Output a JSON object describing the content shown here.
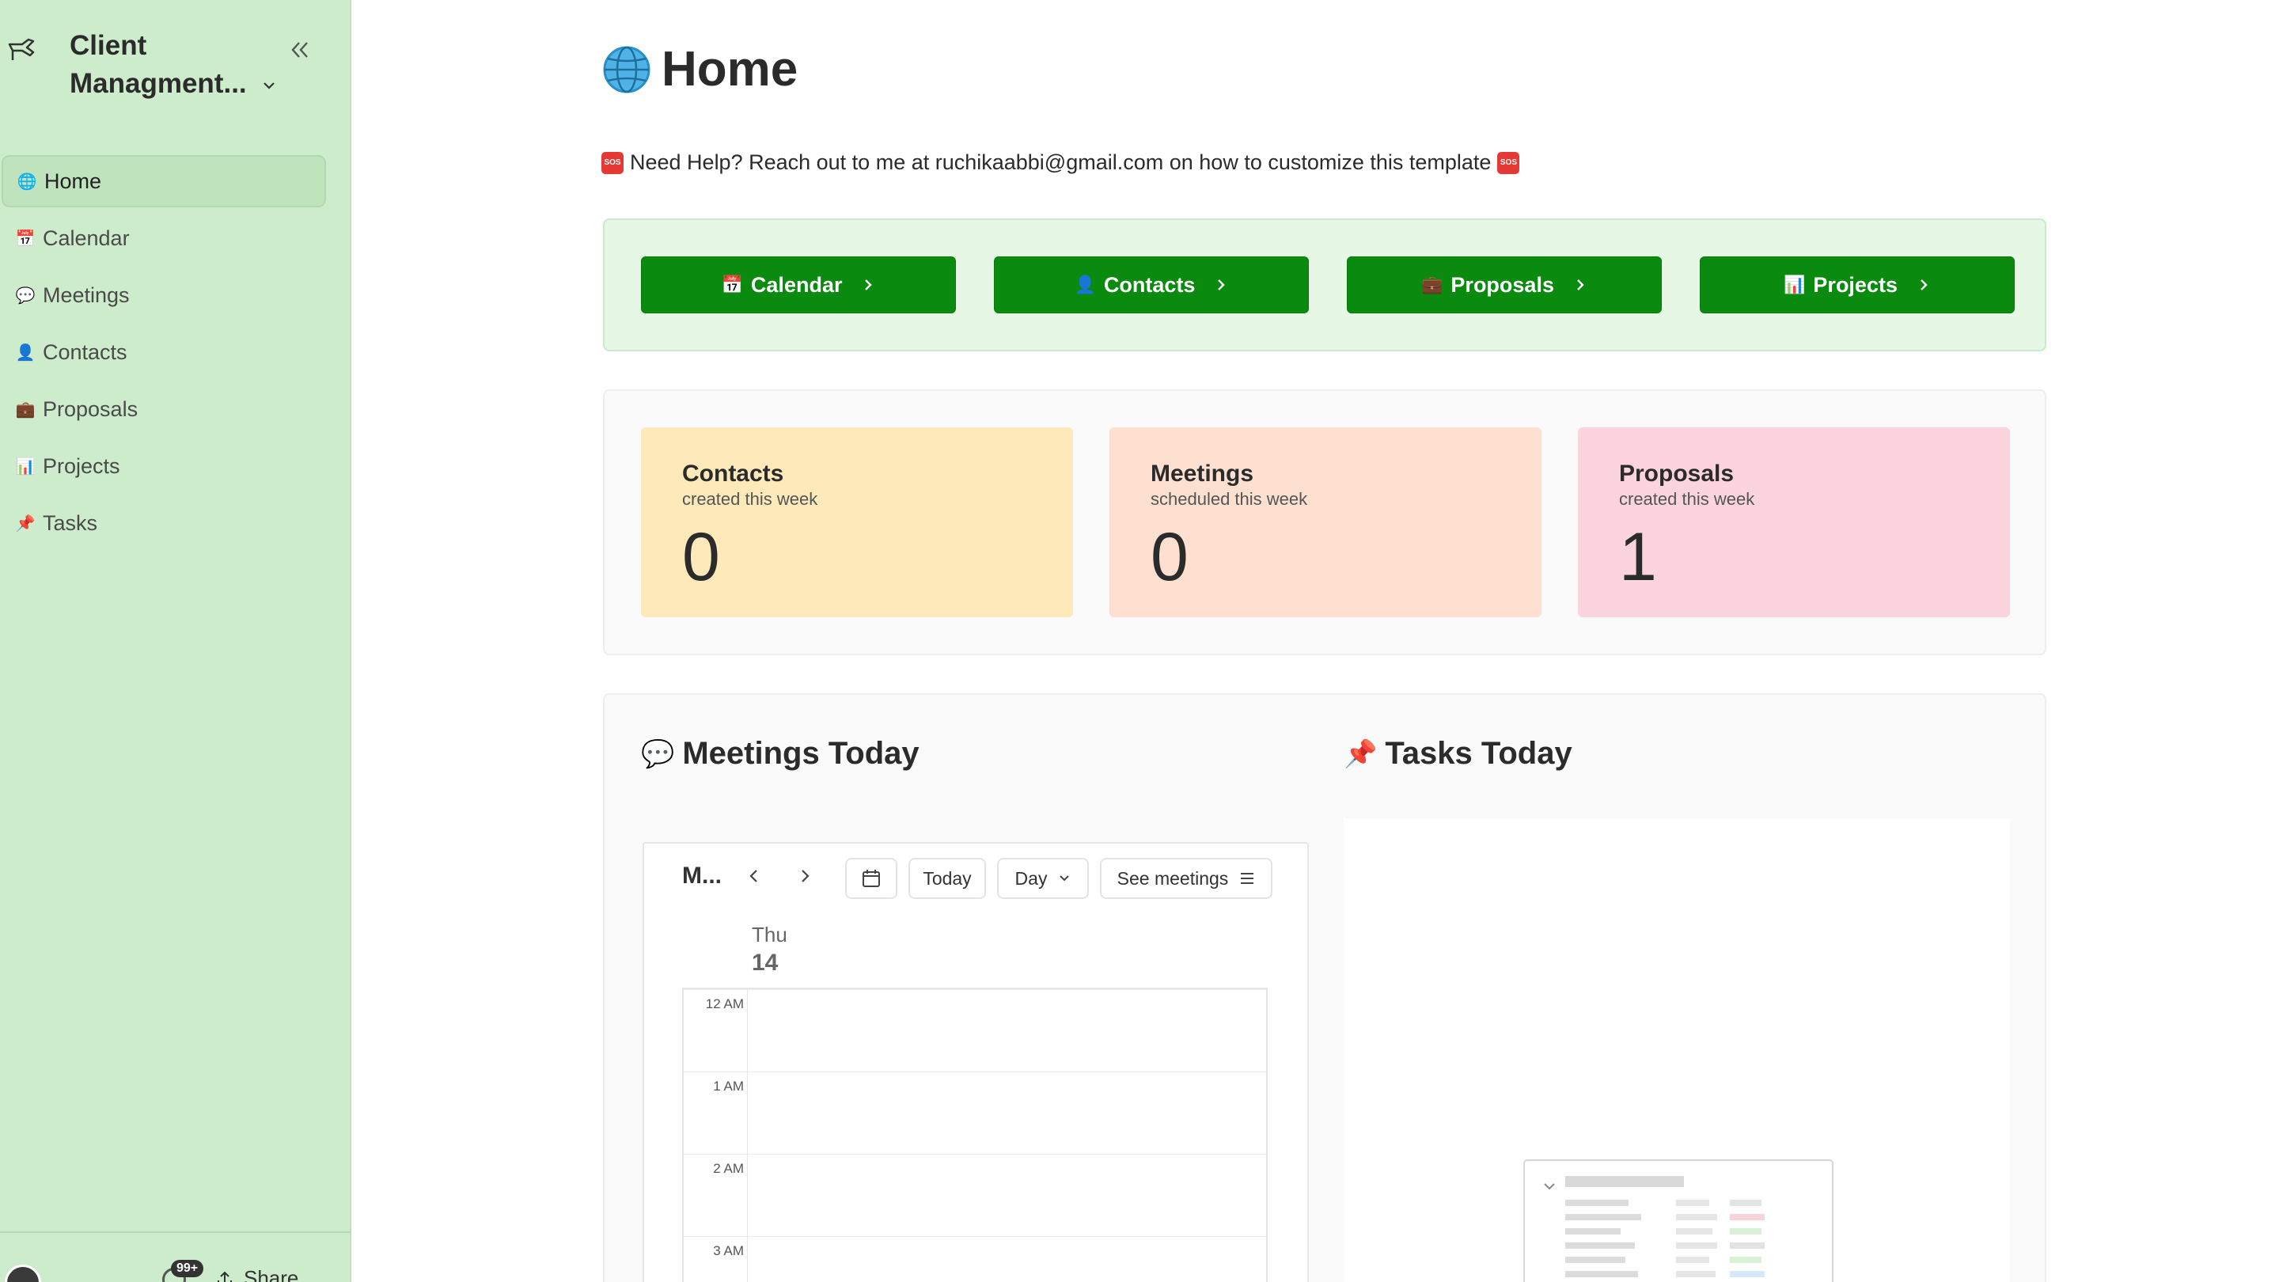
{
  "workspace": {
    "name": "Client Managment..."
  },
  "sidebar": {
    "items": [
      {
        "label": "Home",
        "icon": "globe-icon",
        "emoji": "🌐",
        "active": true
      },
      {
        "label": "Calendar",
        "icon": "calendar-icon",
        "emoji": "📅",
        "active": false
      },
      {
        "label": "Meetings",
        "icon": "speech-bubble-icon",
        "emoji": "💬",
        "active": false
      },
      {
        "label": "Contacts",
        "icon": "person-icon",
        "emoji": "👤",
        "active": false
      },
      {
        "label": "Proposals",
        "icon": "briefcase-icon",
        "emoji": "💼",
        "active": false
      },
      {
        "label": "Projects",
        "icon": "bar-chart-icon",
        "emoji": "📊",
        "active": false
      },
      {
        "label": "Tasks",
        "icon": "pushpin-icon",
        "emoji": "📌",
        "active": false
      }
    ],
    "footer": {
      "badge": "99+",
      "share_label": "Share"
    }
  },
  "page": {
    "title": "Home",
    "help_text": "Need Help? Reach out to me at ruchikaabbi@gmail.com on how to customize this template"
  },
  "quick_links": [
    {
      "label": "Calendar",
      "emoji": "📅"
    },
    {
      "label": "Contacts",
      "emoji": "👤"
    },
    {
      "label": "Proposals",
      "emoji": "💼"
    },
    {
      "label": "Projects",
      "emoji": "📊"
    }
  ],
  "stats": [
    {
      "title": "Contacts",
      "subtitle": "created this week",
      "value": "0",
      "color": "#fde9b9"
    },
    {
      "title": "Meetings",
      "subtitle": "scheduled this week",
      "value": "0",
      "color": "#fde0cf"
    },
    {
      "title": "Proposals",
      "subtitle": "created this week",
      "value": "1",
      "color": "#fcd4de"
    }
  ],
  "meetings_today": {
    "heading": "Meetings Today",
    "emoji": "💬",
    "calendar": {
      "month_label": "M...",
      "today_label": "Today",
      "view_label": "Day",
      "see_label": "See meetings",
      "day_name": "Thu",
      "day_number": "14",
      "hours": [
        "12 AM",
        "1 AM",
        "2 AM",
        "3 AM"
      ]
    }
  },
  "tasks_today": {
    "heading": "Tasks Today",
    "emoji": "📌"
  },
  "colors": {
    "accent_green": "#0b8a10",
    "sidebar_bg": "#cdeccb",
    "quick_links_bg": "#e6f8e5"
  }
}
